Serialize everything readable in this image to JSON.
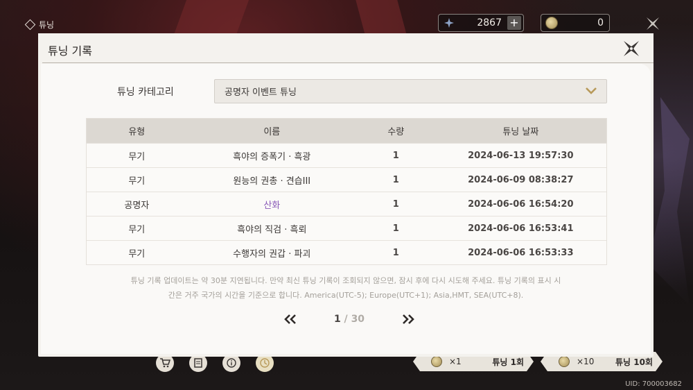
{
  "topbar": {
    "section_label": "튜닝",
    "currency_1": {
      "amount": "2867",
      "plus_label": "+",
      "icon": "star-currency-icon"
    },
    "currency_2": {
      "amount": "0",
      "icon": "coin-currency-icon"
    }
  },
  "bottombar": {
    "icons": [
      "cart-icon",
      "list-icon",
      "info-icon",
      "clock-icon"
    ],
    "tune_1": {
      "mult": "×1",
      "label": "튜닝 1회"
    },
    "tune_10": {
      "mult": "×10",
      "label": "튜닝 10회"
    },
    "uid": "UID: 700003682"
  },
  "modal": {
    "title": "튜닝 기록",
    "category_label": "튜닝 카테고리",
    "category_value": "공명자 이벤트 튜닝",
    "columns": [
      "유형",
      "이름",
      "수량",
      "튜닝 날짜"
    ],
    "rows": [
      {
        "type": "무기",
        "name": "흑야의 증폭기 · 흑광",
        "qty": "1",
        "date": "2024-06-13 19:57:30"
      },
      {
        "type": "무기",
        "name": "원능의 권총 · 견습III",
        "qty": "1",
        "date": "2024-06-09 08:38:27"
      },
      {
        "type": "공명자",
        "name": "산화",
        "qty": "1",
        "date": "2024-06-06 16:54:20"
      },
      {
        "type": "무기",
        "name": "흑야의 직검 · 흑뢰",
        "qty": "1",
        "date": "2024-06-06 16:53:41"
      },
      {
        "type": "무기",
        "name": "수행자의 권갑 · 파괴",
        "qty": "1",
        "date": "2024-06-06 16:53:33"
      }
    ],
    "notice_line_1": "튜닝 기록 업데이트는 약 30분 지연됩니다. 만약 최신 튜닝 기록이 조회되지 않으면, 잠시 후에 다시 시도해 주세요. 튜닝 기록의 표시 시",
    "notice_line_2": "간은 거주 국가의 시간을 기준으로 합니다. America(UTC-5); Europe(UTC+1); Asia,HMT, SEA(UTC+8).",
    "pager": {
      "current": "1",
      "separator": " / ",
      "total": "30"
    }
  },
  "colors": {
    "highlight_name": "#8a5ab8",
    "header_row": "#dcd8d2",
    "accent_chevron": "#b89a5a"
  }
}
